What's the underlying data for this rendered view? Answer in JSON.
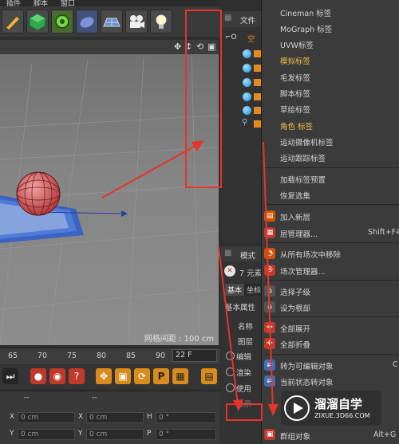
{
  "menubar": {
    "items": [
      "插件",
      "脚本",
      "窗口"
    ]
  },
  "toolbar": {
    "icons": [
      "pen-icon",
      "cube-icon",
      "subdivision-icon",
      "deformer-icon",
      "floor-icon",
      "camera-icon",
      "light-icon"
    ]
  },
  "viewport": {
    "grid_label": "网格间距 : 100 cm"
  },
  "timeline": {
    "ticks": [
      "65",
      "70",
      "75",
      "80",
      "85",
      "90"
    ],
    "frame": "22 F"
  },
  "coords": {
    "rows": [
      {
        "label": "X",
        "value": "0 cm",
        "label2": "X",
        "value2": "0 cm",
        "label3": "H",
        "value3": "0 °"
      },
      {
        "label": "Y",
        "value": "0 cm",
        "label2": "Y",
        "value2": "0 cm",
        "label3": "P",
        "value3": "0 °"
      }
    ],
    "dash1": "--",
    "dash2": "--"
  },
  "object_manager": {
    "tab": "文件",
    "first_item": "空"
  },
  "attribute_manager": {
    "tab": "模式",
    "count_text": "7 元素",
    "tabs": [
      "基本",
      "坐标"
    ],
    "section": "基本属性",
    "rows": [
      "名称",
      "图层",
      "编辑",
      "渲染",
      "使用",
      "显示"
    ]
  },
  "context_menu": {
    "group1": [
      "Cineman 标签",
      "MoGraph 标签",
      "UVW标签",
      "模拟标签",
      "毛发标签",
      "脚本标签",
      "草绘标签",
      "角色 标签",
      "运动摄像机标签",
      "运动跟踪标签"
    ],
    "group2": [
      "加载标签预置",
      "恢复选集"
    ],
    "group3": [
      {
        "label": "加入新层",
        "icon": "layer-add-icon"
      },
      {
        "label": "层管理器...",
        "icon": "layer-manager-icon",
        "shortcut": "Shift+F4"
      }
    ],
    "group4": [
      {
        "label": "从所有场次中移除",
        "icon": "take-remove-icon"
      },
      {
        "label": "场次管理器...",
        "icon": "take-manager-icon"
      }
    ],
    "group5": [
      {
        "label": "选择子级",
        "icon": "select-children-icon"
      },
      {
        "label": "设为根部",
        "icon": "set-root-icon"
      }
    ],
    "group6": [
      {
        "label": "全部展开",
        "icon": "expand-all-icon"
      },
      {
        "label": "全部折叠",
        "icon": "collapse-all-icon"
      }
    ],
    "group7": [
      {
        "label": "转为可编辑对象",
        "icon": "make-editable-icon",
        "shortcut": "C"
      },
      {
        "label": "当前状态转对象",
        "icon": "current-state-icon"
      }
    ],
    "last": {
      "label": "群组对象",
      "icon": "group-icon",
      "shortcut": "Alt+G"
    },
    "highlighted": [
      "模拟标签",
      "角色 标签"
    ]
  },
  "watermark": {
    "title": "溜溜自学",
    "subtitle": "ZIXUE.3D66.COM"
  },
  "colors": {
    "highlight": "#f0c048",
    "annotation": "#e8332a",
    "menu_bg": "#3b3b3b"
  }
}
